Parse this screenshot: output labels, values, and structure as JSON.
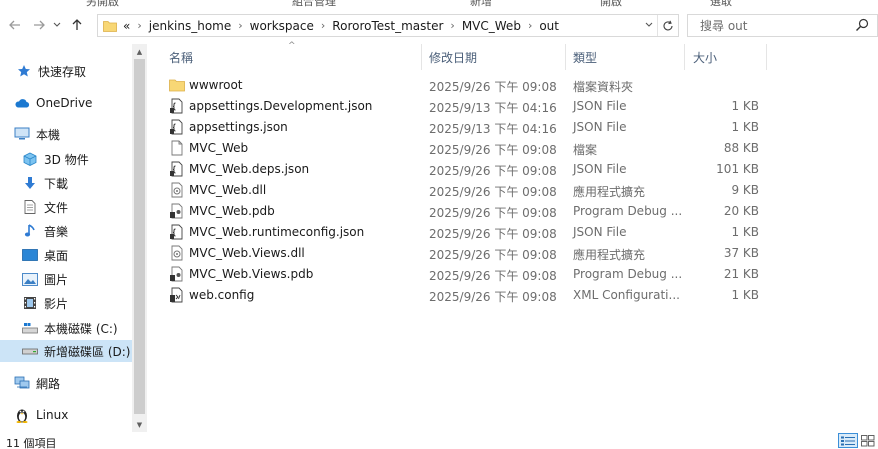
{
  "ribbon": {
    "labels": [
      "另開啟",
      "組合管理",
      "新增",
      "開啟",
      "選取"
    ]
  },
  "nav": {
    "back_icon": "arrow-left-icon",
    "forward_icon": "arrow-right-icon",
    "recent_icon": "chevron-down-icon",
    "up_icon": "arrow-up-icon"
  },
  "address": {
    "overflow": "«",
    "crumbs": [
      "jenkins_home",
      "workspace",
      "RororoTest_master",
      "MVC_Web",
      "out"
    ]
  },
  "search": {
    "placeholder": "搜尋 out"
  },
  "sidebar": {
    "items": [
      {
        "label": "快速存取",
        "icon": "star-icon"
      },
      {
        "label": "OneDrive",
        "icon": "cloud-icon"
      },
      {
        "label": "本機",
        "icon": "computer-icon"
      },
      {
        "label": "3D 物件",
        "icon": "cube-icon"
      },
      {
        "label": "下載",
        "icon": "download-arrow-icon"
      },
      {
        "label": "文件",
        "icon": "document-icon"
      },
      {
        "label": "音樂",
        "icon": "music-note-icon"
      },
      {
        "label": "桌面",
        "icon": "desktop-icon"
      },
      {
        "label": "圖片",
        "icon": "picture-icon"
      },
      {
        "label": "影片",
        "icon": "film-icon"
      },
      {
        "label": "本機磁碟 (C:)",
        "icon": "drive-windows-icon"
      },
      {
        "label": "新增磁碟區 (D:)",
        "icon": "drive-icon"
      },
      {
        "label": "網路",
        "icon": "network-icon"
      },
      {
        "label": "Linux",
        "icon": "linux-penguin-icon"
      }
    ]
  },
  "columns": {
    "name": "名稱",
    "modified": "修改日期",
    "type": "類型",
    "size": "大小"
  },
  "files": [
    {
      "name": "wwwroot",
      "modified": "2025/9/26 下午 09:08",
      "type": "檔案資料夾",
      "size": "",
      "icon": "folder-icon"
    },
    {
      "name": "appsettings.Development.json",
      "modified": "2025/9/13 下午 04:16",
      "type": "JSON File",
      "size": "1 KB",
      "icon": "json-file-icon"
    },
    {
      "name": "appsettings.json",
      "modified": "2025/9/13 下午 04:16",
      "type": "JSON File",
      "size": "1 KB",
      "icon": "json-file-icon"
    },
    {
      "name": "MVC_Web",
      "modified": "2025/9/26 下午 09:08",
      "type": "檔案",
      "size": "88 KB",
      "icon": "blank-file-icon"
    },
    {
      "name": "MVC_Web.deps.json",
      "modified": "2025/9/26 下午 09:08",
      "type": "JSON File",
      "size": "101 KB",
      "icon": "json-file-icon"
    },
    {
      "name": "MVC_Web.dll",
      "modified": "2025/9/26 下午 09:08",
      "type": "應用程式擴充",
      "size": "9 KB",
      "icon": "dll-file-icon"
    },
    {
      "name": "MVC_Web.pdb",
      "modified": "2025/9/26 下午 09:08",
      "type": "Program Debug ...",
      "size": "20 KB",
      "icon": "pdb-file-icon"
    },
    {
      "name": "MVC_Web.runtimeconfig.json",
      "modified": "2025/9/26 下午 09:08",
      "type": "JSON File",
      "size": "1 KB",
      "icon": "json-file-icon"
    },
    {
      "name": "MVC_Web.Views.dll",
      "modified": "2025/9/26 下午 09:08",
      "type": "應用程式擴充",
      "size": "37 KB",
      "icon": "dll-file-icon"
    },
    {
      "name": "MVC_Web.Views.pdb",
      "modified": "2025/9/26 下午 09:08",
      "type": "Program Debug ...",
      "size": "21 KB",
      "icon": "pdb-file-icon"
    },
    {
      "name": "web.config",
      "modified": "2025/9/26 下午 09:08",
      "type": "XML Configurati...",
      "size": "1 KB",
      "icon": "config-file-icon"
    }
  ],
  "status": {
    "item_count": "11 個項目"
  },
  "view": {
    "details_icon": "details-view-icon",
    "tiles_icon": "large-icons-view-icon"
  }
}
